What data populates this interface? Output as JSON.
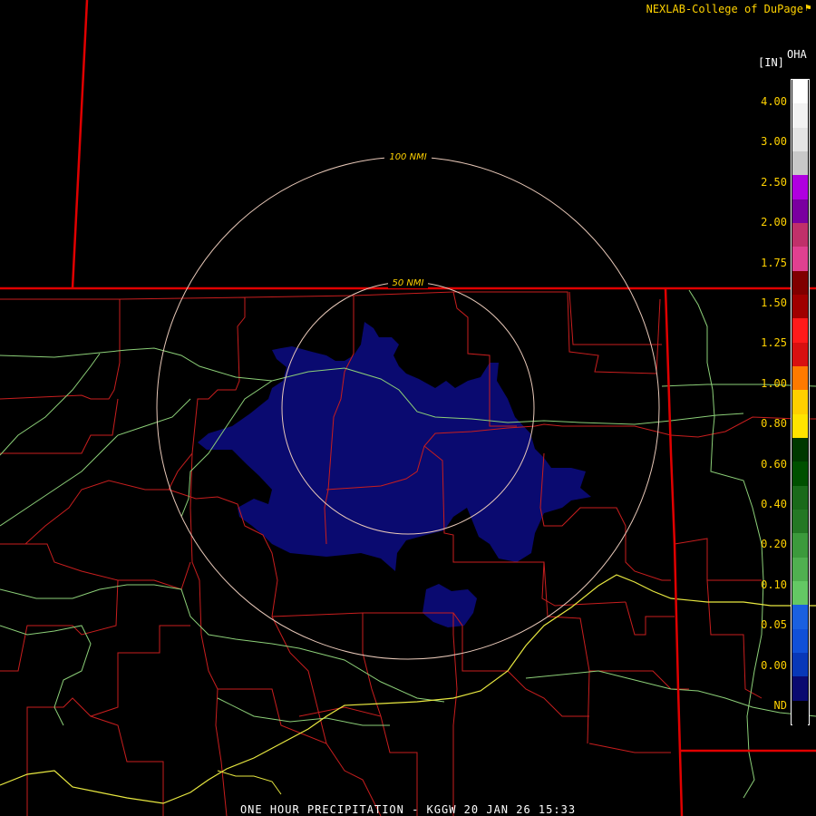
{
  "header": {
    "brand": "NEXLAB-College of DuPage",
    "brand_icon": "flag-icon"
  },
  "product": {
    "code": "OHA",
    "unit": "[IN]"
  },
  "rings": [
    {
      "label": "100 NMI"
    },
    {
      "label": "50 NMI"
    }
  ],
  "legend": {
    "labels": [
      "4.00",
      "3.00",
      "2.50",
      "2.00",
      "1.75",
      "1.50",
      "1.25",
      "1.00",
      "0.80",
      "0.60",
      "0.40",
      "0.20",
      "0.10",
      "0.05",
      "0.00",
      "ND"
    ],
    "colors": [
      "#ffffff",
      "#f2f2f2",
      "#e4e4e4",
      "#c8c8c8",
      "#b000e0",
      "#7a00a0",
      "#c0306a",
      "#e04090",
      "#800000",
      "#a00000",
      "#ff1a1a",
      "#d81010",
      "#ff7a00",
      "#ffd000",
      "#ffe400",
      "#003800",
      "#005000",
      "#1a6a1a",
      "#247824",
      "#3c9a3c",
      "#50b050",
      "#64c864",
      "#1a60e0",
      "#1050d8",
      "#0838b8",
      "#0a0a70",
      "#000000"
    ]
  },
  "footer": {
    "caption": "ONE HOUR PRECIPITATION - KGGW 20 JAN 26 15:33"
  },
  "colors": {
    "accent": "#ffd200",
    "state_line": "#e00000",
    "county_line": "#c81e1e",
    "highway": "#e8e840",
    "road": "#8ccf78",
    "ring": "#e8c8b8",
    "precip": "#0a0a70"
  }
}
